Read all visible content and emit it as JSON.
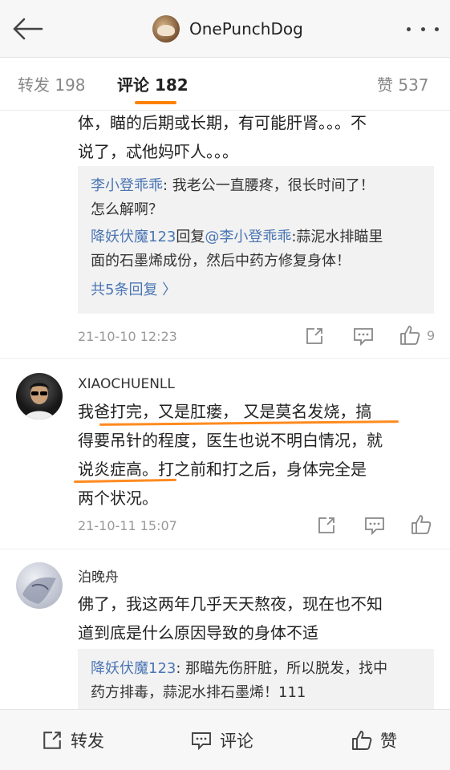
{
  "header": {
    "title": "OnePunchDog",
    "back_icon": "arrow-left-icon",
    "more_icon": "more-dots-icon"
  },
  "tabs": [
    {
      "label": "转发 198"
    },
    {
      "label": "评论 182"
    },
    {
      "label": "赞 537"
    }
  ],
  "accent_color": "#ff8200",
  "comment0": {
    "lines": [
      "体，瞄的后期或长期，有可能肝肾。。。不",
      "说了，忒他妈吓人。。。"
    ],
    "replies": [
      {
        "user": "李小登乖乖",
        "text": ": 我老公一直腰疼，很长时间了！",
        "text2": "怎么解啊？"
      },
      {
        "user": "降妖伏魔123",
        "mid": "回复",
        "target": "@李小登乖乖",
        "text": ":蒜泥水排瞄里",
        "text2": "面的石墨烯成份，然后中药方修复身体！"
      }
    ],
    "more_replies": "共5条回复 〉",
    "time": "21-10-10 12:23",
    "like_count": "9"
  },
  "comment1": {
    "username": "XIAOCHUENLL",
    "lines": [
      "我爸打完，又是肛瘘， 又是莫名发烧，搞",
      "得要吊针的程度，医生也说不明白情况，就",
      "说炎症高。打之前和打之后，身体完全是",
      "两个状况。"
    ],
    "time": "21-10-11 15:07"
  },
  "comment2": {
    "username": "泊晚舟",
    "lines": [
      "佛了，我这两年几乎天天熬夜，现在也不知",
      "道到底是什么原因导致的身体不适"
    ],
    "reply_user": "降妖伏魔123",
    "reply_text": ": 那瞄先伤肝脏，所以脱发，找中",
    "reply_text2": "药方排毒，蒜泥水排石墨烯！111"
  },
  "bottom": {
    "repost": "转发",
    "comment": "评论",
    "like": "赞"
  }
}
